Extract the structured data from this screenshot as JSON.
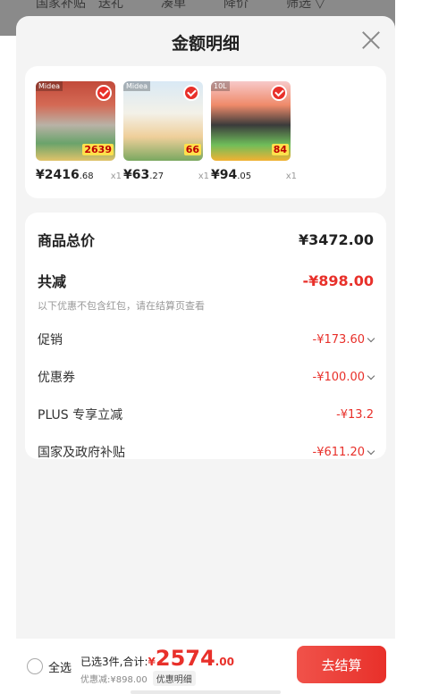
{
  "underlay": {
    "filters": [
      "国家补贴",
      "送礼",
      "凑单",
      "降价",
      "筛选 ▽"
    ]
  },
  "sheet": {
    "title": "金额明细",
    "close_icon": "close-icon"
  },
  "products": [
    {
      "price_int": "¥2416",
      "price_dec": ".68",
      "qty": "x1",
      "thumb_tag": "Midea",
      "thumb_badge": "2639"
    },
    {
      "price_int": "¥63",
      "price_dec": ".27",
      "qty": "x1",
      "thumb_tag": "Midea",
      "thumb_badge": "66"
    },
    {
      "price_int": "¥94",
      "price_dec": ".05",
      "qty": "x1",
      "thumb_tag": "10L",
      "thumb_badge": "84"
    }
  ],
  "details": {
    "total_label": "商品总价",
    "total_value": "¥3472.00",
    "reduce_label": "共减",
    "reduce_value": "-¥898.00",
    "note": "以下优惠不包含红包，请在结算页查看",
    "items": [
      {
        "label": "促销",
        "value": "-¥173.60"
      },
      {
        "label": "优惠券",
        "value": "-¥100.00"
      },
      {
        "label": "PLUS 专享立减",
        "value": "-¥13.2"
      },
      {
        "label": "国家及政府补贴",
        "value": "-¥611.20"
      }
    ]
  },
  "bottom": {
    "select_all": "全选",
    "selected_text": "已选3件,合计:",
    "total_currency": "¥",
    "total_int": "2574",
    "total_dec": ".00",
    "discount_text": "优惠减:¥898.00",
    "detail_button": "优惠明细",
    "checkout_button": "去结算"
  },
  "colors": {
    "accent": "#e8302a",
    "sheet_bg": "#f4f4f4"
  }
}
